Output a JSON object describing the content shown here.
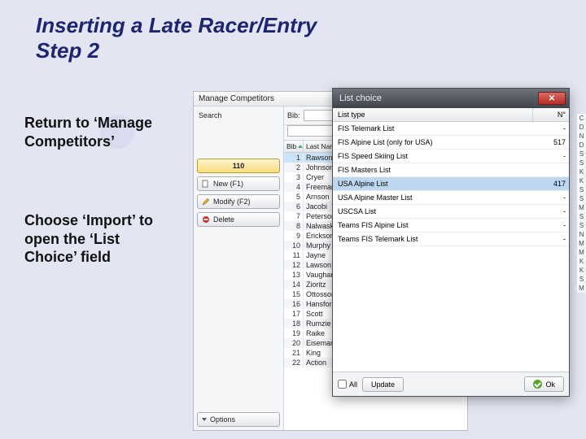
{
  "title_line1": "Inserting a Late Racer/Entry",
  "title_line2": "Step 2",
  "instructions": {
    "p1": "Return to ‘Manage Competitors’",
    "p2": "Choose ‘Import’ to open the ‘List Choice’ field"
  },
  "manage": {
    "window_title": "Manage Competitors",
    "search_label": "Search",
    "bib_label": "Bib:",
    "count_btn": "110",
    "buttons": {
      "new": "New (F1)",
      "modify": "Modify (F2)",
      "delete": "Delete",
      "options": "Options"
    },
    "columns": {
      "bib": "Bib",
      "name": "Last Name"
    },
    "rows": [
      {
        "n": "1",
        "name": "Rawson"
      },
      {
        "n": "2",
        "name": "Johnson"
      },
      {
        "n": "3",
        "name": "Cryer"
      },
      {
        "n": "4",
        "name": "Freeman"
      },
      {
        "n": "5",
        "name": "Arnson"
      },
      {
        "n": "6",
        "name": "Jacobi"
      },
      {
        "n": "7",
        "name": "Peterson"
      },
      {
        "n": "8",
        "name": "Nalwasky"
      },
      {
        "n": "9",
        "name": "Erickson"
      },
      {
        "n": "10",
        "name": "Murphy"
      },
      {
        "n": "11",
        "name": "Jayne"
      },
      {
        "n": "12",
        "name": "Lawson"
      },
      {
        "n": "13",
        "name": "Vaughan"
      },
      {
        "n": "14",
        "name": "Zioritz"
      },
      {
        "n": "15",
        "name": "Ottosson"
      },
      {
        "n": "16",
        "name": "Hansford"
      },
      {
        "n": "17",
        "name": "Scott"
      },
      {
        "n": "18",
        "name": "Rumzie"
      },
      {
        "n": "19",
        "name": "Raike"
      },
      {
        "n": "20",
        "name": "Eiseman"
      },
      {
        "n": "21",
        "name": "King"
      },
      {
        "n": "22",
        "name": "Action"
      }
    ]
  },
  "listchoice": {
    "title": "List choice",
    "col_type": "List type",
    "col_n": "N°",
    "rows": [
      {
        "label": "FIS Telemark List",
        "n": "-",
        "sel": false,
        "group": false
      },
      {
        "label": "FIS Alpine List (only for USA)",
        "n": "517",
        "sel": false,
        "group": false
      },
      {
        "label": "FIS Speed Skiing List",
        "n": "-",
        "sel": false,
        "group": false
      },
      {
        "label": "FIS Masters List",
        "n": "",
        "sel": false,
        "group": false
      },
      {
        "label": "USA Alpine List",
        "n": "417",
        "sel": true,
        "group": false
      },
      {
        "label": "USA Alpine Master List",
        "n": "-",
        "sel": false,
        "group": false
      },
      {
        "label": "USCSA List",
        "n": "-",
        "sel": false,
        "group": false
      },
      {
        "label": "Teams FIS Alpine List",
        "n": "-",
        "sel": false,
        "group": false
      },
      {
        "label": "Teams FIS Telemark List",
        "n": "-",
        "sel": false,
        "group": false
      }
    ],
    "all_label": "All",
    "update_btn": "Update",
    "ok_btn": "Ok"
  },
  "edge_letters": [
    "C",
    "D",
    "N",
    "D",
    "S",
    "S",
    "K",
    "K",
    "S",
    "S",
    "M",
    "S",
    "S",
    "N",
    "M",
    "M",
    "K",
    "K",
    "S",
    "M"
  ]
}
